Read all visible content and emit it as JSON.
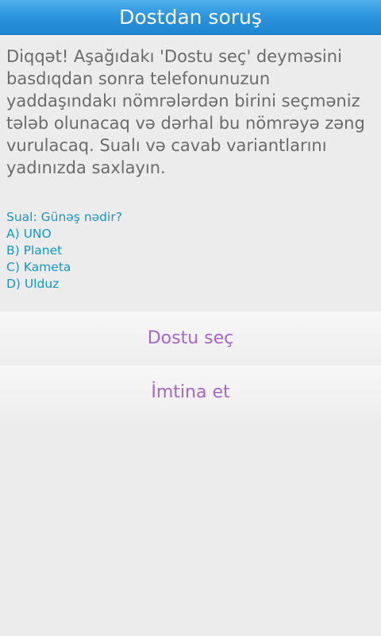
{
  "header": {
    "title": "Dostdan soruş"
  },
  "warning_text": "Diqqət! Aşağıdakı 'Dostu seç' deyməsini\nbasdıqdan sonra telefonunuzun\nyaddaşındakı nömrələrdən birini seçməniz\ntələb olunacaq və dərhal bu nömrəyə zəng\nvurulacaq. Sualı və cavab variantlarını\nyadınızda saxlayın.",
  "question": {
    "text": "Sual: Günəş nədir?",
    "options": [
      "A) UNO",
      "B) Planet",
      "C) Kameta",
      "D) Ulduz"
    ]
  },
  "actions": {
    "choose_friend_label": "Dostu seç",
    "cancel_label": "İmtina et"
  },
  "colors": {
    "header": "#2a93dc",
    "warning_text": "#6b6b6b",
    "question_text": "#1597c8",
    "button_text": "#a567c9",
    "background": "#ececec"
  }
}
